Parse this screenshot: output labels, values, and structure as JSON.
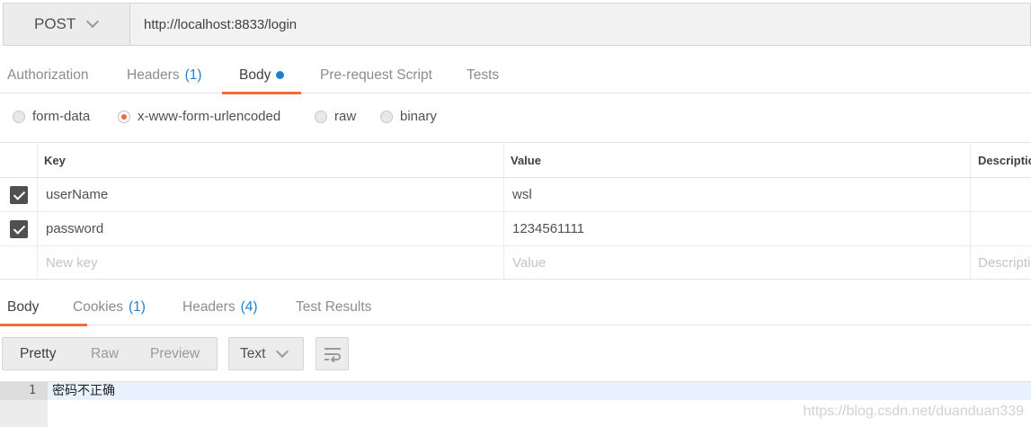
{
  "request": {
    "method": "POST",
    "url": "http://localhost:8833/login"
  },
  "request_tabs": [
    {
      "label": "Authorization",
      "count": ""
    },
    {
      "label": "Headers",
      "count": "(1)"
    },
    {
      "label": "Body",
      "count": "",
      "active": true,
      "dot": true
    },
    {
      "label": "Pre-request Script",
      "count": ""
    },
    {
      "label": "Tests",
      "count": ""
    }
  ],
  "body_types": [
    {
      "label": "form-data",
      "selected": false
    },
    {
      "label": "x-www-form-urlencoded",
      "selected": true
    },
    {
      "label": "raw",
      "selected": false
    },
    {
      "label": "binary",
      "selected": false
    }
  ],
  "params": {
    "columns": [
      "Key",
      "Value",
      "Description"
    ],
    "rows": [
      {
        "checked": true,
        "key": "userName",
        "value": "wsl"
      },
      {
        "checked": true,
        "key": "password",
        "value": "1234561111"
      }
    ],
    "placeholders": {
      "key": "New key",
      "value": "Value",
      "description": "Description"
    }
  },
  "response_tabs": [
    {
      "label": "Body",
      "count": "",
      "active": true
    },
    {
      "label": "Cookies",
      "count": "(1)"
    },
    {
      "label": "Headers",
      "count": "(4)"
    },
    {
      "label": "Test Results",
      "count": ""
    }
  ],
  "response_view": {
    "modes": [
      "Pretty",
      "Raw",
      "Preview"
    ],
    "active_mode": "Pretty",
    "format": "Text"
  },
  "response_body": {
    "line_number": "1",
    "text": "密码不正确"
  },
  "watermark": "https://blog.csdn.net/duanduan339",
  "colors": {
    "accent": "#f26b3a",
    "link": "#1f7fd1"
  },
  "icons": {
    "dropdown": "chevron-down-icon",
    "wrap": "wrap-lines-icon",
    "check": "check-icon"
  }
}
